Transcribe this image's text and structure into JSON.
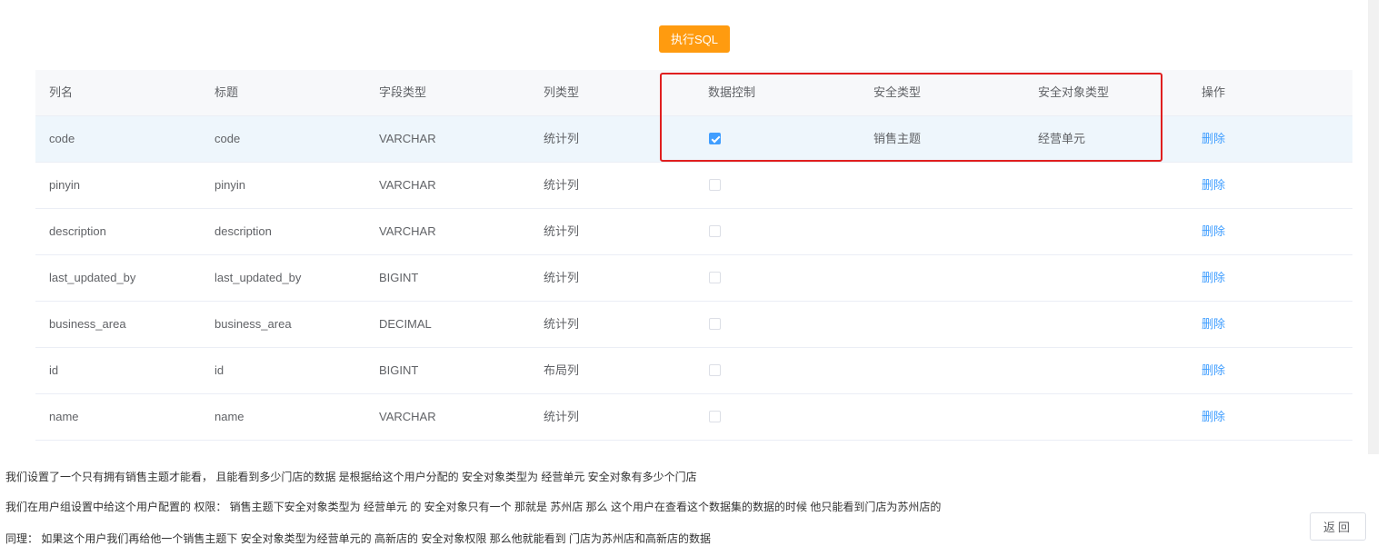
{
  "toolbar": {
    "exec_sql_label": "执行SQL"
  },
  "table": {
    "headers": [
      "列名",
      "标题",
      "字段类型",
      "列类型",
      "数据控制",
      "安全类型",
      "安全对象类型",
      "操作"
    ],
    "rows": [
      {
        "name": "code",
        "title": "code",
        "field_type": "VARCHAR",
        "column_type": "统计列",
        "data_control": true,
        "security_type": "销售主题",
        "security_object_type": "经营单元",
        "action": "删除"
      },
      {
        "name": "pinyin",
        "title": "pinyin",
        "field_type": "VARCHAR",
        "column_type": "统计列",
        "data_control": false,
        "security_type": "",
        "security_object_type": "",
        "action": "删除"
      },
      {
        "name": "description",
        "title": "description",
        "field_type": "VARCHAR",
        "column_type": "统计列",
        "data_control": false,
        "security_type": "",
        "security_object_type": "",
        "action": "删除"
      },
      {
        "name": "last_updated_by",
        "title": "last_updated_by",
        "field_type": "BIGINT",
        "column_type": "统计列",
        "data_control": false,
        "security_type": "",
        "security_object_type": "",
        "action": "删除"
      },
      {
        "name": "business_area",
        "title": "business_area",
        "field_type": "DECIMAL",
        "column_type": "统计列",
        "data_control": false,
        "security_type": "",
        "security_object_type": "",
        "action": "删除"
      },
      {
        "name": "id",
        "title": "id",
        "field_type": "BIGINT",
        "column_type": "布局列",
        "data_control": false,
        "security_type": "",
        "security_object_type": "",
        "action": "删除"
      },
      {
        "name": "name",
        "title": "name",
        "field_type": "VARCHAR",
        "column_type": "统计列",
        "data_control": false,
        "security_type": "",
        "security_object_type": "",
        "action": "删除"
      }
    ]
  },
  "notes": [
    "我们设置了一个只有拥有销售主题才能看， 且能看到多少门店的数据 是根据给这个用户分配的 安全对象类型为 经营单元 安全对象有多少个门店",
    "我们在用户组设置中给这个用户配置的 权限： 销售主题下安全对象类型为 经营单元 的 安全对象只有一个 那就是 苏州店 那么 这个用户在查看这个数据集的数据的时候 他只能看到门店为苏州店的",
    "同理： 如果这个用户我们再给他一个销售主题下 安全对象类型为经营单元的 高新店的 安全对象权限 那么他就能看到 门店为苏州店和高新店的数据"
  ],
  "footer": {
    "back_label": "返回"
  },
  "colors": {
    "accent": "#ff9b0f",
    "link": "#409eff",
    "highlight_border": "#e01f1f"
  }
}
